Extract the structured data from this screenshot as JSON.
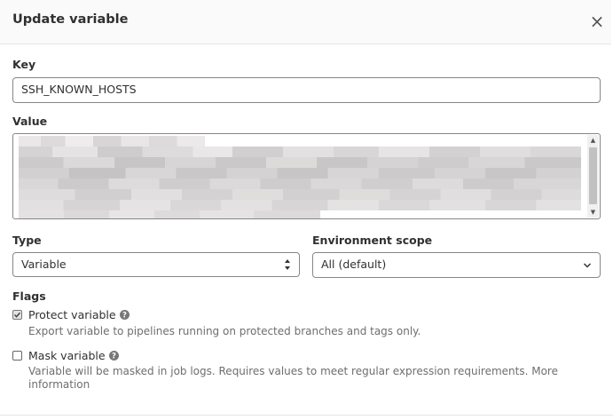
{
  "dialog": {
    "title": "Update variable",
    "close_glyph": "×"
  },
  "key": {
    "label": "Key",
    "value": "SSH_KNOWN_HOSTS"
  },
  "value": {
    "label": "Value"
  },
  "type": {
    "label": "Type",
    "selected": "Variable"
  },
  "environment": {
    "label": "Environment scope",
    "selected": "All (default)"
  },
  "flags": {
    "label": "Flags",
    "protect": {
      "label": "Protect variable",
      "checked": true,
      "description": "Export variable to pipelines running on protected branches and tags only."
    },
    "mask": {
      "label": "Mask variable",
      "checked": false,
      "description_line1": "Variable will be masked in job logs. Requires values to meet regular expression requirements. More",
      "description_line2": "information"
    }
  },
  "icons": {
    "close": "close-icon",
    "help": "question-circle-icon",
    "select_arrows": "up-down-arrows-icon",
    "chevron": "chevron-down-icon",
    "check": "check-icon"
  },
  "colors": {
    "header_bg": "#fafafa",
    "border": "#868686",
    "text": "#303030",
    "muted": "#6e6e6e"
  }
}
